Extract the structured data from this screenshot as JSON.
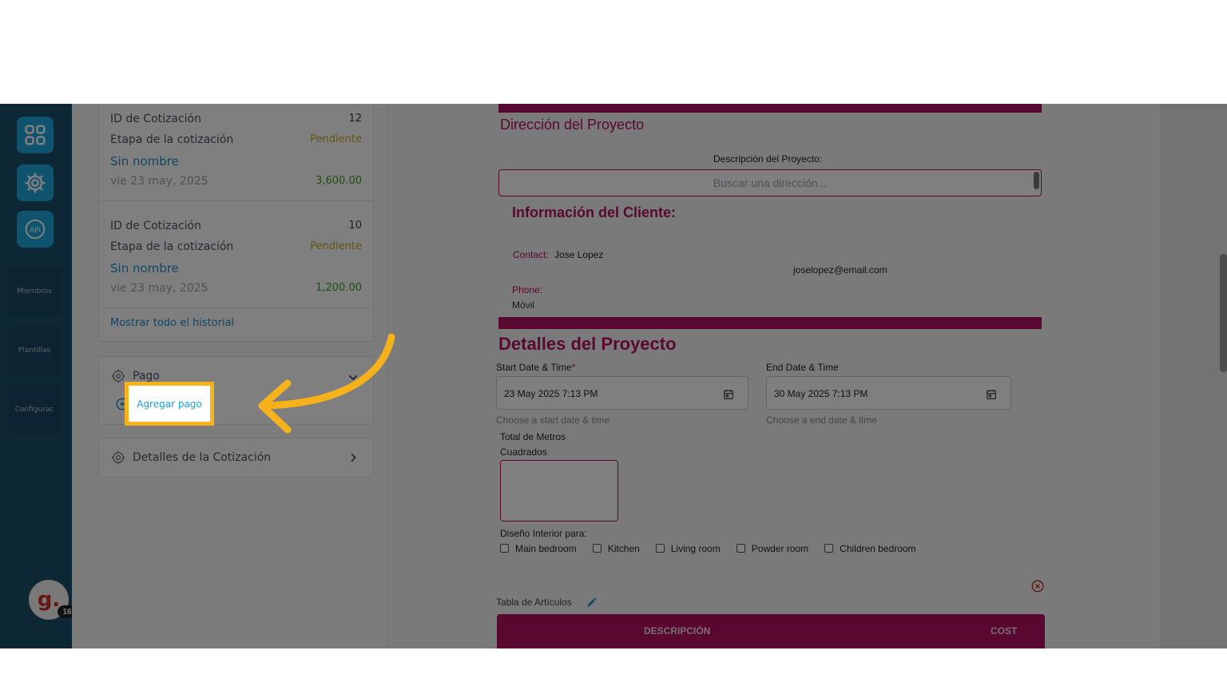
{
  "sidebar": {
    "items": [
      {
        "icon": "grid-icon"
      },
      {
        "icon": "gear-icon"
      },
      {
        "icon": "api-icon",
        "label": "API"
      },
      {
        "label": "Miembros"
      },
      {
        "label": "Plantillas"
      },
      {
        "label": "Configurac"
      }
    ],
    "avatar": {
      "letter": "g.",
      "badge": "16"
    }
  },
  "history": {
    "quotes": [
      {
        "id_label": "ID de Cotización",
        "id": "12",
        "stage_label": "Etapa de la cotización",
        "stage": "Pendiente",
        "name": "Sin nombre",
        "date": "vie 23 may, 2025",
        "amount": "3,600.00"
      },
      {
        "id_label": "ID de Cotización",
        "id": "10",
        "stage_label": "Etapa de la cotización",
        "stage": "Pendiente",
        "name": "Sin nombre",
        "date": "vie 23 may, 2025",
        "amount": "1,200.00"
      }
    ],
    "show_all": "Mostrar todo el historial"
  },
  "payment": {
    "title": "Pago",
    "add_label": "Agregar pago"
  },
  "quote_details": {
    "title": "Detalles de la Cotización"
  },
  "form": {
    "address_title": "Dirección del Proyecto",
    "project_desc_label": "Descripción del Proyecto:",
    "address_placeholder": "Buscar una dirección...",
    "client_title": "Información del Cliente:",
    "contact_label": "Contact:",
    "contact_name": "Jose Lopez",
    "email": "joselopez@email.com",
    "phone_label": "Phone:",
    "phone_type": "Móvil",
    "details_title": "Detalles del Proyecto",
    "start_label": "Start Date & Time",
    "start_required": "*",
    "start_value": "23 May 2025 7:13 PM",
    "start_help": "Choose a start date & time",
    "end_label": "End Date & Time",
    "end_value": "30 May 2025 7:13 PM",
    "end_help": "Choose a end date & time",
    "area_label_1": "Total de Metros",
    "area_label_2": "Cuadrados",
    "interior_label": "Diseño Interior para:",
    "rooms": [
      "Main bedroom",
      "Kitchen",
      "Living room",
      "Powder room",
      "Children bedroom"
    ],
    "items_table_label": "Tabla de Artículos",
    "table_headers": {
      "description": "DESCRIPCIÓN",
      "cost": "COST"
    }
  },
  "colors": {
    "accent": "#b3125f",
    "highlight": "#f6b21a",
    "rail": "#1d4e6b",
    "rail_button": "#1fa6dd"
  }
}
